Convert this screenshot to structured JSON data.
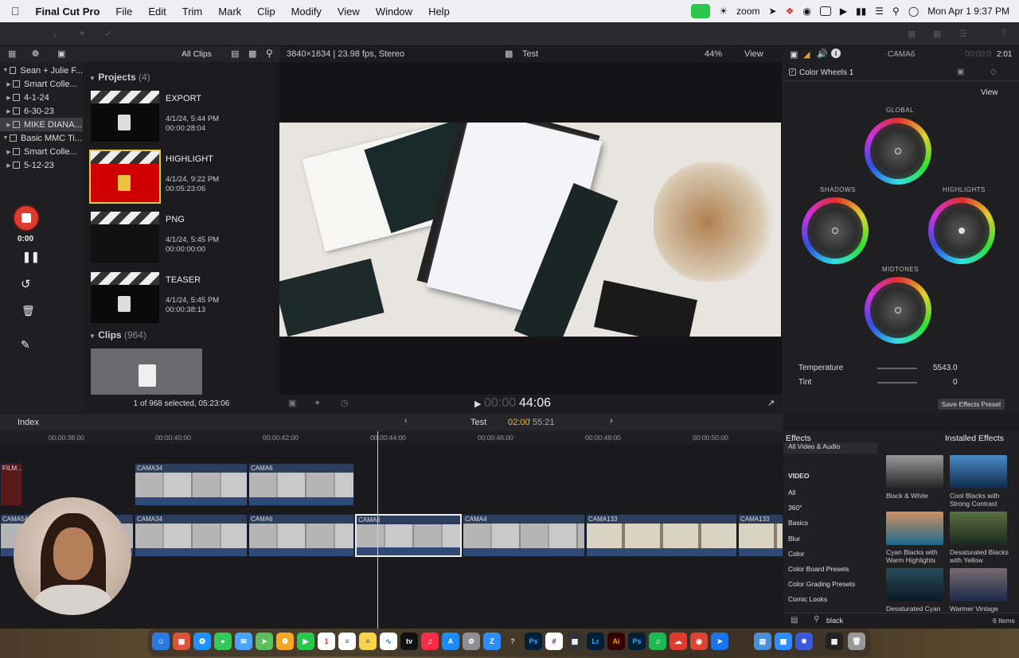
{
  "menubar": {
    "app_name": "Final Cut Pro",
    "items": [
      "File",
      "Edit",
      "Trim",
      "Mark",
      "Clip",
      "Modify",
      "View",
      "Window",
      "Help"
    ],
    "zoom_label": "zoom",
    "datetime": "Mon Apr 1  9:37 PM"
  },
  "browser": {
    "filter_label": "All Clips",
    "library": [
      {
        "label": "Sean + Julie F...",
        "level": 0,
        "expanded": true
      },
      {
        "label": "Smart Colle...",
        "level": 1
      },
      {
        "label": "4-1-24",
        "level": 1
      },
      {
        "label": "6-30-23",
        "level": 1
      },
      {
        "label": "MIKE DIANA...",
        "level": 1,
        "selected": true
      },
      {
        "label": "Basic MMC Ti...",
        "level": 0,
        "expanded": true
      },
      {
        "label": "Smart Colle...",
        "level": 1
      },
      {
        "label": "5-12-23",
        "level": 1
      }
    ],
    "projects_header": "Projects",
    "projects_count": "(4)",
    "projects": [
      {
        "name": "EXPORT",
        "date": "4/1/24, 5:44 PM",
        "duration": "00:00:28:04"
      },
      {
        "name": "HIGHLIGHT",
        "date": "4/1/24, 9:22 PM",
        "duration": "00:05:23:06"
      },
      {
        "name": "PNG",
        "date": "4/1/24, 5:45 PM",
        "duration": "00:00:00:00"
      },
      {
        "name": "TEASER",
        "date": "4/1/24, 5:45 PM",
        "duration": "00:00:38:13"
      }
    ],
    "clips_header": "Clips",
    "clips_count": "(964)",
    "selection_status": "1 of 968 selected, 05:23:06"
  },
  "recorder": {
    "time": "0:00"
  },
  "viewer": {
    "format": "3840×1634 | 23.98 fps, Stereo",
    "project_name": "Test",
    "zoom": "44%",
    "view_label": "View",
    "timecode_dim": "00:00",
    "timecode": "44:06"
  },
  "inspector": {
    "clip_name": "CAMA6",
    "duration_dim": "00:00:0",
    "duration": "2:01",
    "effect_name": "Color Wheels 1",
    "view_label": "View",
    "wheels": {
      "global": "GLOBAL",
      "shadows": "SHADOWS",
      "highlights": "HIGHLIGHTS",
      "midtones": "MIDTONES"
    },
    "temperature_label": "Temperature",
    "temperature_value": "5543.0",
    "tint_label": "Tint",
    "tint_value": "0",
    "save_preset": "Save Effects Preset"
  },
  "timeline": {
    "index_label": "Index",
    "project_name": "Test",
    "position": "02:00",
    "total": "55:21",
    "ruler": [
      "00:00:38:00",
      "00:00:40:00",
      "00:00:42:00",
      "00:00:44:00",
      "00:00:46:00",
      "00:00:48:00",
      "00:00:50:00"
    ],
    "upper_clips": [
      "FILM...",
      "CAMA34",
      "CAMA6"
    ],
    "main_clips": [
      "CAMA54",
      "CAMA34",
      "CAMA6",
      "CAMA6",
      "CAMA4",
      "CAMA133",
      "CAMA133"
    ]
  },
  "effects": {
    "title": "Effects",
    "installed": "Installed Effects",
    "all_label": "All Video & Audio",
    "section": "VIDEO",
    "categories": [
      "All",
      "360°",
      "Basics",
      "Blur",
      "Color",
      "Color Board Presets",
      "Color Grading Presets",
      "Comic Looks"
    ],
    "items": [
      {
        "label": "Black & White",
        "colors": [
          "#222",
          "#999"
        ]
      },
      {
        "label": "Cool Blacks with Strong Contrast",
        "colors": [
          "#0d2a4a",
          "#4a8ac9"
        ]
      },
      {
        "label": "Cyan Blacks with Warm Highlights",
        "colors": [
          "#1a6a8a",
          "#d09060"
        ]
      },
      {
        "label": "Desaturated Blacks with Yellow",
        "colors": [
          "#1a2a20",
          "#5a7040"
        ]
      },
      {
        "label": "Desaturated Cyan",
        "colors": [
          "#0a1a25",
          "#2a4a5a"
        ]
      },
      {
        "label": "Warmer Vintage",
        "colors": [
          "#1a2a4a",
          "#7a6a70"
        ]
      }
    ],
    "search": "black",
    "count": "6 Items"
  }
}
